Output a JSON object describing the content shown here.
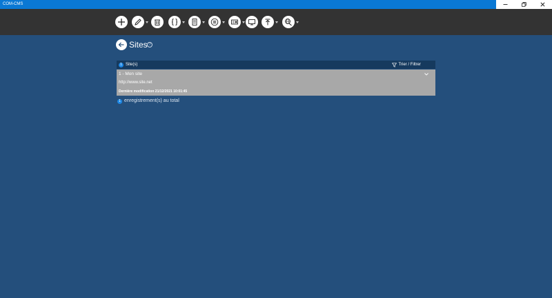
{
  "window": {
    "title": "COM-CMS",
    "controls": [
      "minimize",
      "restore",
      "close"
    ]
  },
  "toolbar": {
    "items": [
      {
        "name": "add",
        "icon": "plus-icon",
        "has_dropdown": false
      },
      {
        "name": "edit",
        "icon": "pencil-icon",
        "has_dropdown": true
      },
      {
        "name": "delete",
        "icon": "trash-icon",
        "has_dropdown": false
      },
      {
        "name": "code",
        "icon": "braces-icon",
        "has_dropdown": true
      },
      {
        "name": "document",
        "icon": "document-icon",
        "has_dropdown": true
      },
      {
        "name": "list",
        "icon": "list-icon",
        "has_dropdown": true
      },
      {
        "name": "card",
        "icon": "card-icon",
        "has_dropdown": true
      },
      {
        "name": "display",
        "icon": "monitor-icon",
        "has_dropdown": false
      },
      {
        "name": "upload",
        "icon": "upload-icon",
        "has_dropdown": true
      },
      {
        "name": "web",
        "icon": "web-icon",
        "has_dropdown": true
      }
    ]
  },
  "page": {
    "title": "Sites",
    "help_symbol": "?"
  },
  "list": {
    "header_label": "Site(s)",
    "header_count": "1",
    "filter_label": "Trier / Filtrer",
    "items": [
      {
        "title": "1 - Mon site",
        "url": "http://www.site.net",
        "modified": "Dernière modification 21/12/2021 10:01:45"
      }
    ],
    "total_count": "1",
    "total_label": "enregistrement(s) au total"
  },
  "colors": {
    "titlebar": "#0a78d4",
    "toolbar": "#333333",
    "background": "#244f7c",
    "list_header": "#163a5e",
    "list_item": "#a8a8a8",
    "badge": "#1e88e5"
  }
}
